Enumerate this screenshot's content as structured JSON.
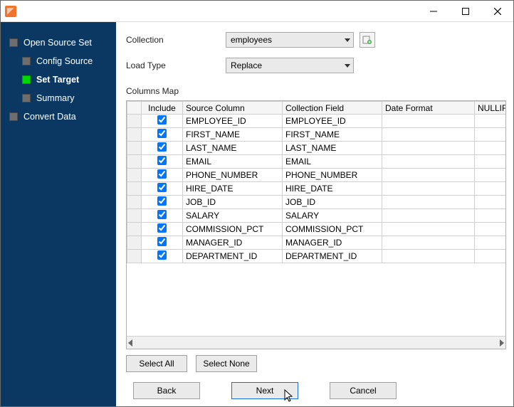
{
  "sidebar": {
    "items": [
      {
        "label": "Open Source Set",
        "level": 0,
        "active": false,
        "bold": false
      },
      {
        "label": "Config Source",
        "level": 1,
        "active": false,
        "bold": false
      },
      {
        "label": "Set Target",
        "level": 1,
        "active": true,
        "bold": true
      },
      {
        "label": "Summary",
        "level": 1,
        "active": false,
        "bold": false
      },
      {
        "label": "Convert Data",
        "level": 0,
        "active": false,
        "bold": false
      }
    ]
  },
  "form": {
    "collection_label": "Collection",
    "collection_value": "employees",
    "loadtype_label": "Load Type",
    "loadtype_value": "Replace"
  },
  "columns_map_label": "Columns Map",
  "grid": {
    "headers": {
      "include": "Include",
      "source": "Source Column",
      "field": "Collection Field",
      "date": "Date Format",
      "nullif": "NULLIF"
    },
    "rows": [
      {
        "include": true,
        "source": "EMPLOYEE_ID",
        "field": "EMPLOYEE_ID",
        "date": "",
        "nullif": ""
      },
      {
        "include": true,
        "source": "FIRST_NAME",
        "field": "FIRST_NAME",
        "date": "",
        "nullif": ""
      },
      {
        "include": true,
        "source": "LAST_NAME",
        "field": "LAST_NAME",
        "date": "",
        "nullif": ""
      },
      {
        "include": true,
        "source": "EMAIL",
        "field": "EMAIL",
        "date": "",
        "nullif": ""
      },
      {
        "include": true,
        "source": "PHONE_NUMBER",
        "field": "PHONE_NUMBER",
        "date": "",
        "nullif": ""
      },
      {
        "include": true,
        "source": "HIRE_DATE",
        "field": "HIRE_DATE",
        "date": "",
        "nullif": ""
      },
      {
        "include": true,
        "source": "JOB_ID",
        "field": "JOB_ID",
        "date": "",
        "nullif": ""
      },
      {
        "include": true,
        "source": "SALARY",
        "field": "SALARY",
        "date": "",
        "nullif": ""
      },
      {
        "include": true,
        "source": "COMMISSION_PCT",
        "field": "COMMISSION_PCT",
        "date": "",
        "nullif": ""
      },
      {
        "include": true,
        "source": "MANAGER_ID",
        "field": "MANAGER_ID",
        "date": "",
        "nullif": ""
      },
      {
        "include": true,
        "source": "DEPARTMENT_ID",
        "field": "DEPARTMENT_ID",
        "date": "",
        "nullif": ""
      }
    ]
  },
  "buttons": {
    "select_all": "Select All",
    "select_none": "Select None",
    "back": "Back",
    "next": "Next",
    "cancel": "Cancel"
  }
}
